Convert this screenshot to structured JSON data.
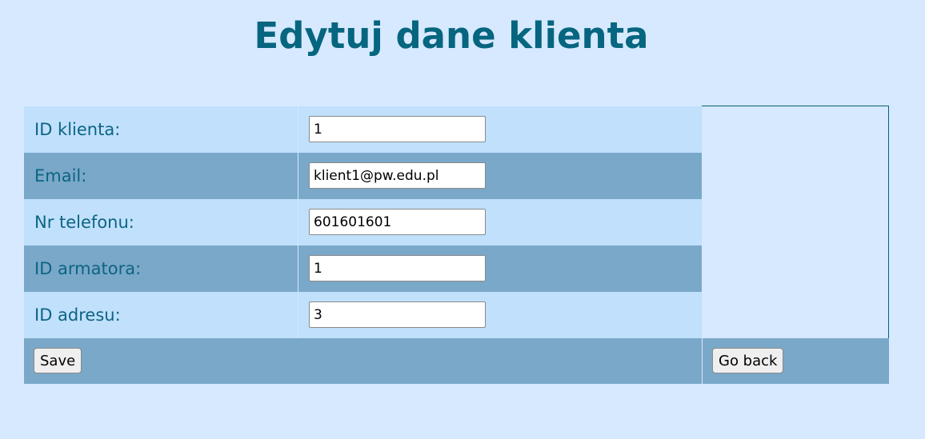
{
  "page": {
    "title": "Edytuj dane klienta"
  },
  "form": {
    "fields": [
      {
        "label": "ID klienta:",
        "value": "1"
      },
      {
        "label": "Email:",
        "value": "klient1@pw.edu.pl"
      },
      {
        "label": "Nr telefonu:",
        "value": "601601601"
      },
      {
        "label": "ID armatora:",
        "value": "1"
      },
      {
        "label": "ID adresu:",
        "value": "3"
      }
    ],
    "save_label": "Save",
    "back_label": "Go back"
  },
  "colors": {
    "background": "#d6e9ff",
    "title": "#06657f",
    "row_light": "#c0e0fc",
    "row_dark": "#7aa8c8",
    "label_text": "#0d6483"
  }
}
